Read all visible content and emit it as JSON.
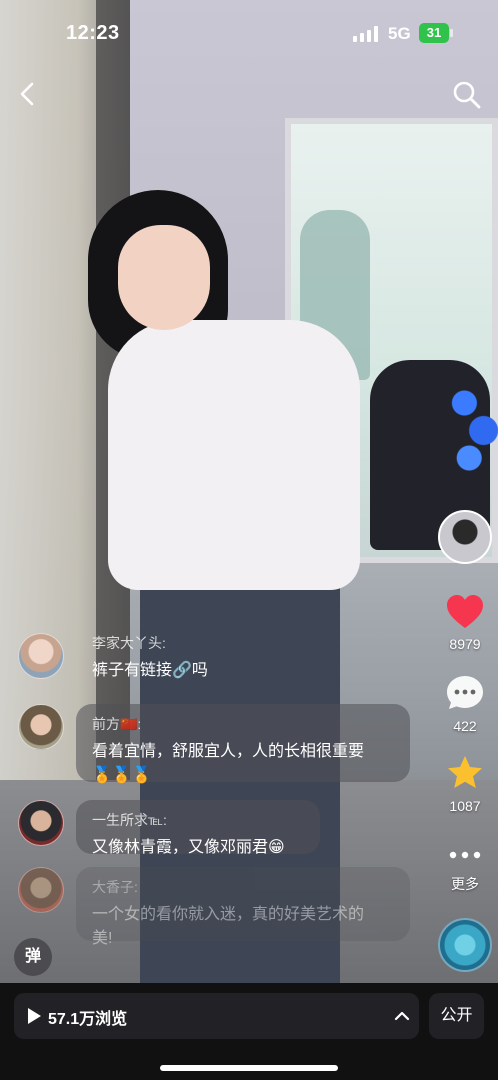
{
  "status_bar": {
    "time": "12:23",
    "network": "5G",
    "battery": "31"
  },
  "header": {
    "back_icon": "chevron-left-icon",
    "search_icon": "search-icon"
  },
  "actions": {
    "likes": "8979",
    "comments": "422",
    "favorites": "1087",
    "more_label": "更多",
    "like_color": "#f6364f",
    "favorite_color": "#fbc02d"
  },
  "comments": [
    {
      "user": "李家大丫头:",
      "text": "裤子有链接🔗吗"
    },
    {
      "user": "前方🇨🇳:",
      "text": "看着宜情，舒服宜人，人的长相很重要",
      "text2": "🏅🏅🏅"
    },
    {
      "user": "一生所求℡:",
      "text": "又像林青霞，又像邓丽君😁"
    },
    {
      "user": "大香子:",
      "text": "一个女的看你就入迷，真的好美艺术的",
      "text2": "美!"
    }
  ],
  "danmu_label": "弹",
  "bottom_bar": {
    "views": "57.1万浏览",
    "public_label": "公开"
  }
}
